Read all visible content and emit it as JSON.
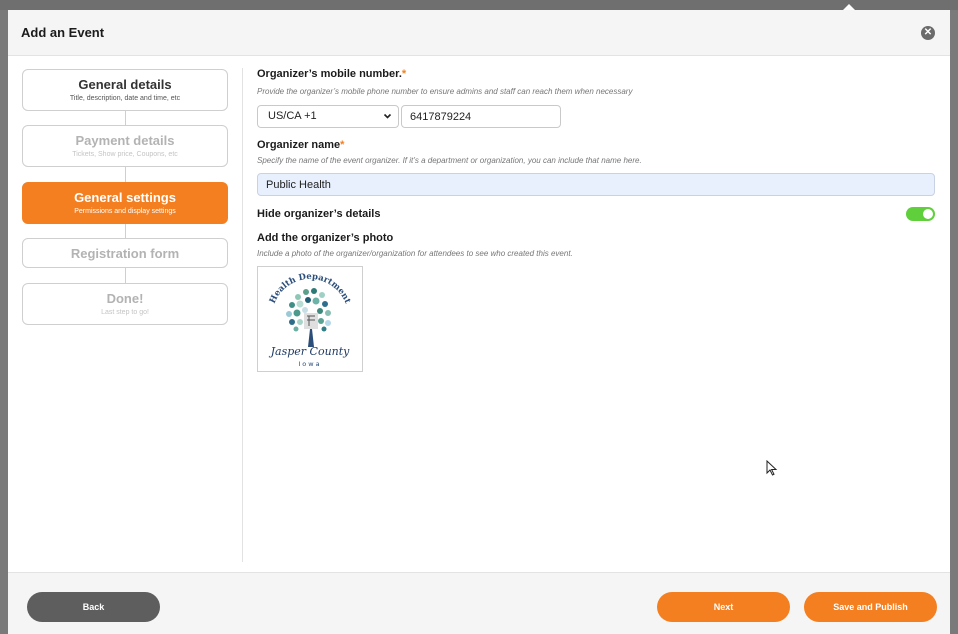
{
  "modal": {
    "title": "Add an Event",
    "close_glyph": "✕"
  },
  "steps": [
    {
      "title": "General details",
      "subtitle": "Title, description, date and time, etc",
      "state": "completed"
    },
    {
      "title": "Payment details",
      "subtitle": "Tickets, Show price, Coupons, etc",
      "state": "disabled"
    },
    {
      "title": "General settings",
      "subtitle": "Permissions and display settings",
      "state": "active"
    },
    {
      "title": "Registration form",
      "subtitle": "",
      "state": "disabled"
    },
    {
      "title": "Done!",
      "subtitle": "Last step to go!",
      "state": "disabled"
    }
  ],
  "form": {
    "mobile": {
      "label": "Organizer’s mobile number.",
      "required_mark": "*",
      "help": "Provide the organizer’s mobile phone number to ensure admins and staff can reach them when necessary",
      "country_code": "US/CA +1",
      "number": "6417879224"
    },
    "name": {
      "label": "Organizer name",
      "required_mark": "*",
      "help": "Specify the name of the event organizer. If it’s a department or organization, you can include that name here.",
      "value": "Public Health"
    },
    "hide_details": {
      "label": "Hide organizer’s details",
      "enabled": true
    },
    "photo": {
      "label": "Add the organizer’s photo",
      "help": "Include a photo of the organizer/organization for attendees to see who created this event.",
      "logo_top_text": "Health Department",
      "logo_script_text": "Jasper County",
      "logo_bottom_text": "Iowa"
    }
  },
  "footer": {
    "back_label": "Back",
    "next_label": "Next",
    "publish_label": "Save and Publish"
  },
  "colors": {
    "accent": "#f47f20",
    "toggle_on": "#5fcf3c",
    "back_button": "#5e5e5e"
  }
}
